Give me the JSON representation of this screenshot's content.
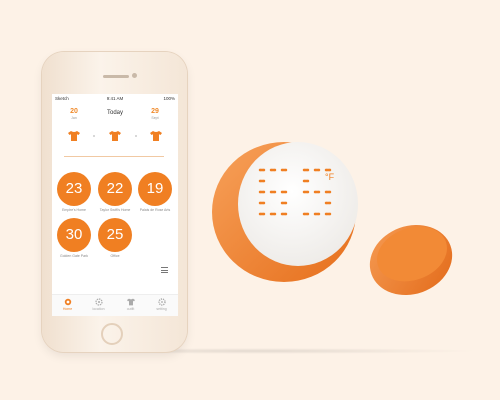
{
  "status_bar": {
    "carrier": "Sketch",
    "time": "9:41 AM",
    "battery": "100%"
  },
  "dates": {
    "prev": {
      "num": "20",
      "month": "Jan"
    },
    "today": "Today",
    "next": {
      "num": "29",
      "month": "Sept"
    }
  },
  "tiles": [
    {
      "temp": "23",
      "label": "Empire's Home"
    },
    {
      "temp": "22",
      "label": "Taylor Swift's Home"
    },
    {
      "temp": "19",
      "label": "Palais de Rose Arts"
    },
    {
      "temp": "30",
      "label": "Golden Gate Park"
    },
    {
      "temp": "25",
      "label": "Office"
    }
  ],
  "tabs": [
    {
      "label": "Home",
      "icon": "sun-icon"
    },
    {
      "label": "location",
      "icon": "gear-icon"
    },
    {
      "label": "outfit",
      "icon": "shirt-icon"
    },
    {
      "label": "setting",
      "icon": "settings-icon"
    }
  ],
  "device": {
    "display_value": "65",
    "unit": "°F"
  },
  "colors": {
    "accent": "#f07f22",
    "background": "#fdf2e7"
  }
}
